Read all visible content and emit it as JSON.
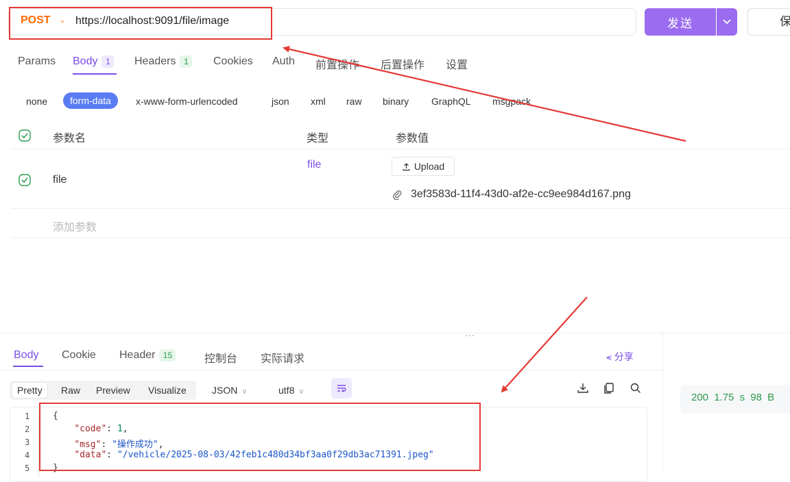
{
  "request": {
    "method": "POST",
    "url": "https://localhost:9091/file/image",
    "send_label": "发送",
    "save_label": "保"
  },
  "request_tabs": [
    {
      "label": "Params"
    },
    {
      "label": "Body",
      "badge": "1"
    },
    {
      "label": "Headers",
      "badge": "1"
    },
    {
      "label": "Cookies"
    },
    {
      "label": "Auth"
    },
    {
      "label": "前置操作"
    },
    {
      "label": "后置操作"
    },
    {
      "label": "设置"
    }
  ],
  "body_types": [
    "none",
    "form-data",
    "x-www-form-urlencoded",
    "json",
    "xml",
    "raw",
    "binary",
    "GraphQL",
    "msgpack"
  ],
  "params_table": {
    "headers": {
      "name": "参数名",
      "type": "类型",
      "value": "参数值"
    },
    "row": {
      "name": "file",
      "type": "file",
      "upload_label": "Upload",
      "file_name": "3ef3583d-11f4-43d0-af2e-cc9ee984d167.png"
    },
    "add_placeholder": "添加参数"
  },
  "divider": "...",
  "response_tabs": [
    {
      "label": "Body"
    },
    {
      "label": "Cookie"
    },
    {
      "label": "Header",
      "badge": "15"
    },
    {
      "label": "控制台"
    },
    {
      "label": "实际请求"
    }
  ],
  "share_label": "分享",
  "format_tabs": [
    "Pretty",
    "Raw",
    "Preview",
    "Visualize"
  ],
  "format_select": "JSON",
  "encoding_select": "utf8",
  "code": {
    "line_numbers": [
      "1",
      "2",
      "3",
      "4",
      "5"
    ],
    "open_brace": "{",
    "code_key": "\"code\"",
    "code_val": "1",
    "msg_key": "\"msg\"",
    "msg_val": "\"操作成功\"",
    "data_key": "\"data\"",
    "data_val": "\"/vehicle/2025-08-03/42feb1c480d34bf3aa0f29db3ac71391.jpeg\"",
    "close_brace": "}"
  },
  "status": {
    "code": "200",
    "time": "1.75 s",
    "size": "98 B"
  },
  "colors": {
    "accent": "#7b4ee6",
    "method": "#ff6a00",
    "annotation": "#e53935"
  }
}
